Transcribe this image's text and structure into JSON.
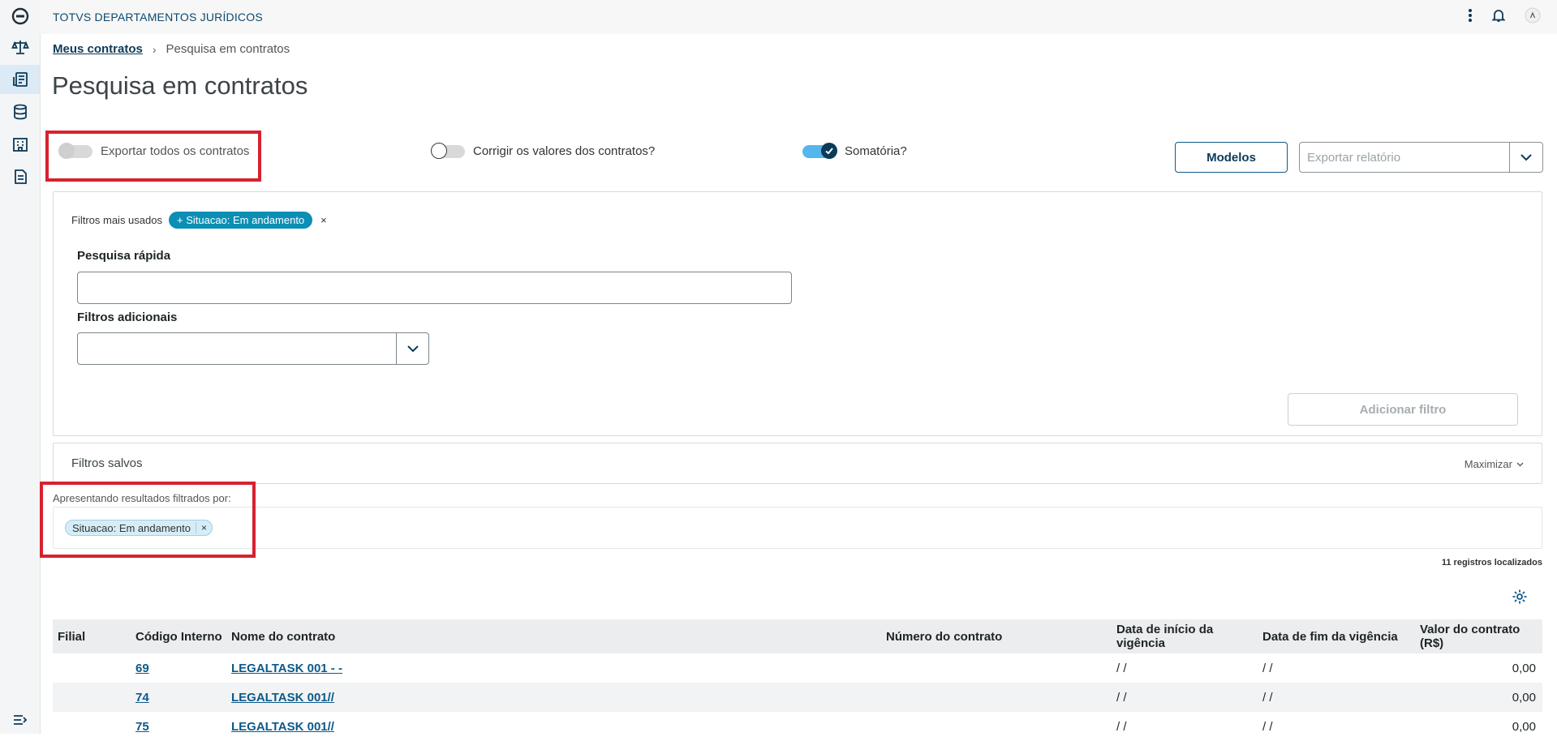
{
  "app": {
    "title": "TOTVS DEPARTAMENTOS JURÍDICOS"
  },
  "sidebar": {
    "items": [
      {
        "icon": "logo-icon"
      },
      {
        "icon": "scale-icon"
      },
      {
        "icon": "contracts-icon",
        "active": true
      },
      {
        "icon": "database-icon"
      },
      {
        "icon": "building-icon"
      },
      {
        "icon": "document-icon"
      }
    ],
    "collapse_icon": "collapse-menu-icon"
  },
  "header": {
    "icons": [
      "more-vertical-icon",
      "bell-icon",
      "user-avatar-icon"
    ]
  },
  "breadcrumb": {
    "link": "Meus contratos",
    "current": "Pesquisa em contratos"
  },
  "page": {
    "title": "Pesquisa em contratos"
  },
  "switches": {
    "exportar": {
      "label": "Exportar todos os contratos",
      "on": false,
      "disabled": true
    },
    "corrigir": {
      "label": "Corrigir os valores dos contratos?",
      "on": false
    },
    "somatoria": {
      "label": "Somatória?",
      "on": true
    }
  },
  "actions": {
    "modelos": "Modelos",
    "export_placeholder": "Exportar relatório"
  },
  "filters": {
    "most_used_label": "Filtros mais usados",
    "chip": "+ Situacao: Em andamento",
    "chip_remove": "×",
    "quick_search_label": "Pesquisa rápida",
    "quick_search_value": "",
    "additional_label": "Filtros adicionais",
    "add_button": "Adicionar filtro"
  },
  "saved": {
    "title": "Filtros salvos",
    "maximize": "Maximizar"
  },
  "results": {
    "label": "Apresentando resultados filtrados por:",
    "chip": "Situacao: Em andamento",
    "chip_remove": "×",
    "count": "11 registros localizados"
  },
  "table": {
    "headers": [
      "Filial",
      "Código Interno",
      "Nome do contrato",
      "Número do contrato",
      "Data de início da vigência",
      "Data de fim da vigência",
      "Valor do contrato (R$)"
    ],
    "rows": [
      {
        "filial": "",
        "codigo": "69",
        "nome": "LEGALTASK 001 - -",
        "numero": "",
        "inicio": "/ /",
        "fim": "/ /",
        "valor": "0,00"
      },
      {
        "filial": "",
        "codigo": "74",
        "nome": "LEGALTASK 001//",
        "numero": "",
        "inicio": "/ /",
        "fim": "/ /",
        "valor": "0,00"
      },
      {
        "filial": "",
        "codigo": "75",
        "nome": "LEGALTASK 001//",
        "numero": "",
        "inicio": "/ /",
        "fim": "/ /",
        "valor": "0,00"
      }
    ]
  },
  "colors": {
    "primary": "#0c3a59",
    "accent": "#0b8fb5",
    "highlight": "#d6222f"
  }
}
